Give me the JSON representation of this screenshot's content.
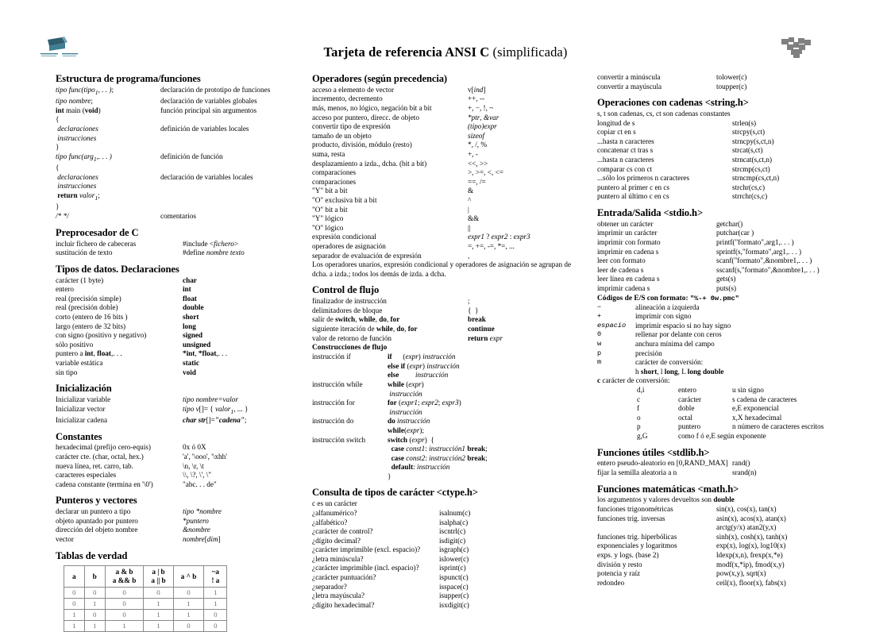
{
  "header": {
    "title_bold": "Tarjeta de referencia ANSI C",
    "title_rest": " (simplificada)",
    "logo_left_name": "institution-logo",
    "logo_right_name": "puzzle-logo"
  },
  "col1": {
    "estructura": {
      "heading": "Estructura de programa/funciones",
      "rows": [
        {
          "lbl_html": "<i>tipo func(tipo</i><sub><i>1</i></sub><i>, . . )</i>;",
          "val": "declaración de prototipo de funciones"
        },
        {
          "lbl_html": "<i>tipo nombre</i>;",
          "val": "declaración de variables globales"
        },
        {
          "lbl_html": "<b>int</b> main (<b>void</b>)",
          "val": "función principal sin argumentos"
        },
        {
          "lbl_html": "{",
          "val": ""
        },
        {
          "lbl_html": "&nbsp;<i>declaraciones</i>",
          "val": "definición de variables locales"
        },
        {
          "lbl_html": "&nbsp;<i>instrucciones</i>",
          "val": ""
        },
        {
          "lbl_html": "}",
          "val": ""
        },
        {
          "lbl_html": "<i>tipo func(arg</i><sub><i>1</i></sub><i>,. . . )</i>",
          "val": "definición de función"
        },
        {
          "lbl_html": "{",
          "val": ""
        },
        {
          "lbl_html": "&nbsp;<i>declaraciones</i>",
          "val": "declaración de variables locales"
        },
        {
          "lbl_html": "&nbsp;<i>instrucciones</i>",
          "val": ""
        },
        {
          "lbl_html": "&nbsp;<b>return</b> <i>valor</i><sub><i>1</i></sub>;",
          "val": ""
        },
        {
          "lbl_html": "}",
          "val": ""
        },
        {
          "lbl_html": "<i>/* */</i>",
          "val": "comentarios"
        }
      ]
    },
    "preprocesador": {
      "heading": "Preprocesador de C",
      "rows": [
        {
          "lbl_html": "incluir fichero de cabeceras",
          "val_html": "#include &lt;<i>fichero</i>&gt;"
        },
        {
          "lbl_html": "sustitución de texto",
          "val_html": "#define <i>nombre texto</i>"
        }
      ]
    },
    "tipos": {
      "heading": "Tipos de datos. Declaraciones",
      "rows": [
        {
          "lbl_html": "carácter (1 byte)",
          "val_html": "<b>char</b>"
        },
        {
          "lbl_html": "entero",
          "val_html": "<b>int</b>"
        },
        {
          "lbl_html": "real (precisión simple)",
          "val_html": "<b>float</b>"
        },
        {
          "lbl_html": "real (precisión doble)",
          "val_html": "<b>double</b>"
        },
        {
          "lbl_html": "corto (entero de 16 bits )",
          "val_html": "<b>short</b>"
        },
        {
          "lbl_html": "largo (entero de 32 bits)",
          "val_html": "<b>long</b>"
        },
        {
          "lbl_html": "con signo (positivo y negativo)",
          "val_html": "<b>signed</b>"
        },
        {
          "lbl_html": "sólo positivo",
          "val_html": "<b>unsigned</b>"
        },
        {
          "lbl_html": "puntero a <b>int</b>, <b>float</b>,. . .",
          "val_html": "<b>*int</b>, <b>*float</b>,. . ."
        },
        {
          "lbl_html": "variable estática",
          "val_html": "<b>static</b>"
        },
        {
          "lbl_html": "sin tipo",
          "val_html": "<b>void</b>"
        }
      ]
    },
    "inicializacion": {
      "heading": "Inicialización",
      "rows": [
        {
          "lbl_html": "Inicializar variable",
          "val_html": "<i>tipo nombre=valor</i>"
        },
        {
          "lbl_html": "Inicializar vector",
          "val_html": "<i>tipo v</i>[]= {<i> valor</i><sub><i>1</i></sub><i>, ...</i> }"
        },
        {
          "lbl_html": "Inicializar cadena",
          "val_html": "<b><i>char str</i></b>[]=<b><i>\"cadena\"</i></b>;"
        }
      ]
    },
    "constantes": {
      "heading": "Constantes",
      "rows": [
        {
          "lbl_html": "hexadecimal (prefijo cero-equis)",
          "val_html": "0x ó 0X"
        },
        {
          "lbl_html": "carácter cte. (char, octal, hex.)",
          "val_html": "'a', '\\ooo', '\\xhh'"
        },
        {
          "lbl_html": "nueva línea, ret. carro, tab.",
          "val_html": "\\n, \\r, \\t"
        },
        {
          "lbl_html": "caracteres especiales",
          "val_html": "\\\\, \\?, \\', \\\""
        },
        {
          "lbl_html": "cadena constante (termina en '\\0')",
          "val_html": "\"abc. . . de\""
        }
      ]
    },
    "punteros": {
      "heading": "Punteros y vectores",
      "rows": [
        {
          "lbl_html": "declarar un puntero a tipo",
          "val_html": "<i>tipo *nombre</i>"
        },
        {
          "lbl_html": "objeto apuntado por puntero",
          "val_html": "<i>*puntero</i>"
        },
        {
          "lbl_html": "dirección del objeto nombre",
          "val_html": "<i>&amp;nombre</i>"
        },
        {
          "lbl_html": "vector",
          "val_html": "<i>nombre</i>[<i>dim</i>]"
        }
      ]
    },
    "tablas": {
      "heading": "Tablas de verdad",
      "columns": [
        {
          "line1": "a",
          "line2": ""
        },
        {
          "line1": "b",
          "line2": ""
        },
        {
          "line1": "a &amp; b",
          "line2": "a &amp;&amp; b"
        },
        {
          "line1": "a | b",
          "line2": "a || b"
        },
        {
          "line1": "a ^ b",
          "line2": ""
        },
        {
          "line1": "~a",
          "line2": "! a"
        }
      ],
      "rows": [
        [
          "0",
          "0",
          "0",
          "0",
          "0",
          "1"
        ],
        [
          "0",
          "1",
          "0",
          "1",
          "1",
          "1"
        ],
        [
          "1",
          "0",
          "0",
          "1",
          "1",
          "0"
        ],
        [
          "1",
          "1",
          "1",
          "1",
          "0",
          "0"
        ]
      ]
    }
  },
  "col2": {
    "operadores": {
      "heading": "Operadores (según precedencia)",
      "rows": [
        {
          "lbl_html": "acceso a elemento de vector",
          "val_html": "v[<i>ind</i>]"
        },
        {
          "lbl_html": "incremento, decremento",
          "val_html": "++, --"
        },
        {
          "lbl_html": "más, menos, no lógico, negación bit a bit",
          "val_html": "+, −, !, ~"
        },
        {
          "lbl_html": "acceso por puntero, direcc. de objeto",
          "val_html": "<i>*ptr</i>, <i>&amp;var</i>"
        },
        {
          "lbl_html": "convertir tipo de expresión",
          "val_html": "<i>(tipo)expr</i>"
        },
        {
          "lbl_html": "tamaño de un objeto",
          "val_html": "<i>sizeof</i>"
        },
        {
          "lbl_html": "producto, división, módulo (resto)",
          "val_html": "*, /, %"
        },
        {
          "lbl_html": "suma, resta",
          "val_html": "+, -"
        },
        {
          "lbl_html": "desplazamiento a izda., dcha. (bit a bit)",
          "val_html": "&lt;&lt;, &gt;&gt;"
        },
        {
          "lbl_html": "comparaciones",
          "val_html": "&gt;, &gt;=, &lt;, &lt;="
        },
        {
          "lbl_html": "comparaciones",
          "val_html": "==, /="
        },
        {
          "lbl_html": "\"Y\" bit a bit",
          "val_html": "&amp;"
        },
        {
          "lbl_html": "\"O\" exclusiva bit a bit",
          "val_html": "^"
        },
        {
          "lbl_html": "\"O\" bit a bit",
          "val_html": "|"
        },
        {
          "lbl_html": "\"Y\" lógico",
          "val_html": "&amp;&amp;"
        },
        {
          "lbl_html": "\"O\" lógico",
          "val_html": "||"
        },
        {
          "lbl_html": "expresión condicional",
          "val_html": "<i>expr1</i> ? <i>expr2</i> : <i>expr3</i>"
        },
        {
          "lbl_html": "operadores de asignación",
          "val_html": "=, +=, -=, *=, ..."
        },
        {
          "lbl_html": "separador de evaluación de expresión",
          "val_html": ","
        }
      ],
      "note": "Los operadores unarios, expresión condicional y operadores de asignación se agrupan de dcha. a izda.; todos los demás de izda. a dcha."
    },
    "control": {
      "heading": "Control de flujo",
      "rows": [
        {
          "lbl_html": "finalizador de instrucción",
          "val_html": ";"
        },
        {
          "lbl_html": "delimitadores de bloque",
          "val_html": "{&nbsp;&nbsp;}"
        },
        {
          "lbl_html": "salir de <b>switch</b>, <b>while</b>, <b>do</b>, <b>for</b>",
          "val_html": "<b>break</b>"
        },
        {
          "lbl_html": "siguiente iteración de <b>while</b>, <b>do</b>, <b>for</b>",
          "val_html": "<b>continue</b>"
        },
        {
          "lbl_html": "valor de retorno de función",
          "val_html": "<b>return</b> <i>expr</i>"
        }
      ],
      "subheading": "Construcciones de flujo",
      "flow": [
        {
          "lbl_html": "instrucción if",
          "val_html": "<b>if</b>&nbsp;&nbsp;&nbsp;&nbsp;&nbsp;&nbsp;(<i>expr</i>) <i>instrucción</i>"
        },
        {
          "lbl_html": "",
          "val_html": "<b>else if</b> (<i>expr</i>) <i>instrucción</i>"
        },
        {
          "lbl_html": "",
          "val_html": "<b>else</b>&nbsp;&nbsp;&nbsp;&nbsp;&nbsp;&nbsp;&nbsp;&nbsp;&nbsp;<i>instrucción</i>"
        },
        {
          "lbl_html": "instrucción while",
          "val_html": "<b>while</b> (<i>expr</i>)"
        },
        {
          "lbl_html": "",
          "val_html": "&nbsp;<i>instrucción</i>"
        },
        {
          "lbl_html": "instrucción for",
          "val_html": "<b>for</b> (<i>expr1</i>; <i>expr2</i>; <i>expr3</i>)"
        },
        {
          "lbl_html": "",
          "val_html": "&nbsp;<i>instrucción</i>"
        },
        {
          "lbl_html": "instrucción do",
          "val_html": "<b>do</b> <i>instrucción</i>"
        },
        {
          "lbl_html": "",
          "val_html": "<b>while</b>(<i>expr</i>);"
        },
        {
          "lbl_html": "instrucción switch",
          "val_html": "<b>switch</b> (<i>expr</i>)&nbsp;&nbsp;{"
        },
        {
          "lbl_html": "",
          "val_html": "&nbsp;&nbsp;<b>case</b> <i>const1</i>: <i>instrucción1</i> <b>break</b>;"
        },
        {
          "lbl_html": "",
          "val_html": "&nbsp;&nbsp;<b>case</b> <i>const2</i>: <i>instrucción2</i> <b>break</b>;"
        },
        {
          "lbl_html": "",
          "val_html": "&nbsp;&nbsp;<b>default</b>: <i>instrucción</i>"
        },
        {
          "lbl_html": "",
          "val_html": "}"
        }
      ]
    },
    "ctype": {
      "heading": "Consulta de tipos de carácter <ctype.h>",
      "note": "c es un carácter",
      "rows": [
        {
          "lbl_html": "¿alfanumérico?",
          "val_html": "isalnum(c)"
        },
        {
          "lbl_html": "¿alfabético?",
          "val_html": "isalpha(c)"
        },
        {
          "lbl_html": "¿carácter de control?",
          "val_html": "iscntrl(c)"
        },
        {
          "lbl_html": "¿dígito decimal?",
          "val_html": "isdigit(c)"
        },
        {
          "lbl_html": "¿carácter imprimible (excl. espacio)?",
          "val_html": "isgraph(c)"
        },
        {
          "lbl_html": "¿letra minúscula?",
          "val_html": "islower(c)"
        },
        {
          "lbl_html": "¿carácter imprimible (incl. espacio)?",
          "val_html": "isprint(c)"
        },
        {
          "lbl_html": "¿carácter puntuación?",
          "val_html": "ispunct(c)"
        },
        {
          "lbl_html": "¿separador?",
          "val_html": "isspace(c)"
        },
        {
          "lbl_html": "¿letra mayúscula?",
          "val_html": "isupper(c)"
        },
        {
          "lbl_html": "¿dígito hexadecimal?",
          "val_html": "isxdigit(c)"
        }
      ]
    }
  },
  "col3": {
    "ctype_tail": {
      "rows": [
        {
          "lbl_html": "convertir a minúscula",
          "val_html": "tolower(c)"
        },
        {
          "lbl_html": "convertir a mayúscula",
          "val_html": "toupper(c)"
        }
      ]
    },
    "cadenas": {
      "heading": "Operaciones con cadenas <string.h>",
      "note": "s, t son cadenas, cs, ct son cadenas constantes",
      "rows": [
        {
          "lbl_html": "longitud de s",
          "val_html": "strlen(s)"
        },
        {
          "lbl_html": "copiar ct en s",
          "val_html": "strcpy(s,ct)"
        },
        {
          "lbl_html": "...hasta n caracteres",
          "val_html": "strncpy(s,ct,n)"
        },
        {
          "lbl_html": "concatenar ct tras s",
          "val_html": "strcat(s,ct)"
        },
        {
          "lbl_html": "...hasta n caracteres",
          "val_html": "strncat(s,ct,n)"
        },
        {
          "lbl_html": "comparar cs con ct",
          "val_html": "strcmp(cs,ct)"
        },
        {
          "lbl_html": "...sólo los primeros n caracteres",
          "val_html": "strncmp(cs,ct,n)"
        },
        {
          "lbl_html": "puntero al primer c en cs",
          "val_html": "strchr(cs,c)"
        },
        {
          "lbl_html": "puntero al último c en cs",
          "val_html": "strrchr(cs,c)"
        }
      ]
    },
    "stdio": {
      "heading": "Entrada/Salida <stdio.h>",
      "rows": [
        {
          "lbl_html": "obtener un carácter",
          "val_html": "getchar()"
        },
        {
          "lbl_html": "imprimir un carácter",
          "val_html": "putchar(car )"
        },
        {
          "lbl_html": "imprimir con formato",
          "val_html": "printf(\"formato\",arg1,. . . )"
        },
        {
          "lbl_html": "imprimir en cadena s",
          "val_html": "sprintf(s,\"formato\",arg1,. . . )"
        },
        {
          "lbl_html": "leer con formato",
          "val_html": "scanf(\"formato\",&amp;nombre1,. . . )"
        },
        {
          "lbl_html": "leer de cadena s",
          "val_html": "sscanf(s,\"formato\",&amp;nombre1,. . . )"
        },
        {
          "lbl_html": "leer línea en cadena s",
          "val_html": "gets(s)"
        },
        {
          "lbl_html": "imprimir cadena s",
          "val_html": "puts(s)"
        }
      ],
      "codes_label": "Códigos de E/S con formato:",
      "codes_value": "\"%-+ 0w.pmc\"",
      "flags": [
        {
          "key_html": "−",
          "desc": "alineación a izquierda"
        },
        {
          "key_html": "+",
          "desc": "imprimir con signo"
        },
        {
          "key_html": "<i>espacio</i>",
          "desc": "imprimir espacio si no hay signo"
        },
        {
          "key_html": "0",
          "desc": "rellenar por delante con ceros"
        },
        {
          "key_html": "w",
          "desc": "anchura mínima del campo"
        },
        {
          "key_html": "p",
          "desc": "precisión"
        },
        {
          "key_html": "m",
          "desc": "carácter de conversión:"
        }
      ],
      "modifiers_html": "h <b>short</b>, l <b>long</b>, L <b>long double</b>",
      "conv_label_html": "<b>c</b> carácter de conversión:",
      "conversions": [
        {
          "c1": "d,i",
          "c2": "entero",
          "c3": "u sin signo"
        },
        {
          "c1": "c",
          "c2": "carácter",
          "c3": "s cadena de caracteres"
        },
        {
          "c1": "f",
          "c2": "doble",
          "c3": "e,E exponencial"
        },
        {
          "c1": "o",
          "c2": "octal",
          "c3": "x,X hexadecimal"
        },
        {
          "c1": "p",
          "c2": "puntero",
          "c3": "n número de caracteres escritos"
        },
        {
          "c1": "g,G",
          "c2": "como f ó e,E según exponente",
          "c3": ""
        }
      ]
    },
    "stdlib": {
      "heading": "Funciones útiles <stdlib.h>",
      "rows": [
        {
          "lbl_html": "entero pseudo-aleatorio en [0,RAND_MAX]",
          "val_html": "rand()"
        },
        {
          "lbl_html": "fijar la semilla aleatoria a n",
          "val_html": "srand(n)"
        }
      ]
    },
    "math": {
      "heading": "Funciones matemáticas <math.h>",
      "note_html": "los argumentos y valores devueltos son <b>double</b>",
      "rows": [
        {
          "lbl_html": "funciones trigonométricas",
          "val_html": "sin(x), cos(x), tan(x)"
        },
        {
          "lbl_html": "funciones trig. inversas",
          "val_html": "asin(x), acos(x), atan(x)"
        },
        {
          "lbl_html": "",
          "val_html": "arctg(y/x) atan2(y,x)"
        },
        {
          "lbl_html": "funciones trig. hiperbólicas",
          "val_html": "sinh(x), cosh(x), tanh(x)"
        },
        {
          "lbl_html": "exponenciales y logaritmos",
          "val_html": "exp(x), log(x), log10(x)"
        },
        {
          "lbl_html": "exps. y logs. (base 2)",
          "val_html": "ldexp(x,n), frexp(x,*e)"
        },
        {
          "lbl_html": "división y resto",
          "val_html": "modf(x,*ip), fmod(x,y)"
        },
        {
          "lbl_html": "potencia y raíz",
          "val_html": "pow(x,y), sqrt(x)"
        },
        {
          "lbl_html": "redondeo",
          "val_html": "ceil(x), floor(x), fabs(x)"
        }
      ]
    }
  }
}
